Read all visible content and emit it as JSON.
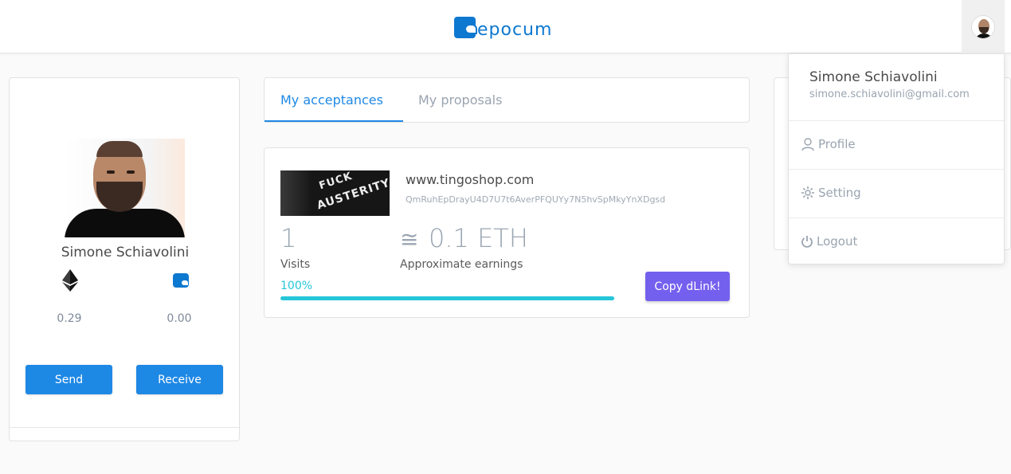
{
  "header": {
    "logo_text": "epocum"
  },
  "profile": {
    "name": "Simone Schiavolini",
    "balances": {
      "eth": "0.29",
      "epc": "0.00"
    },
    "send_label": "Send",
    "receive_label": "Receive"
  },
  "tabs": [
    {
      "label": "My acceptances",
      "active": true
    },
    {
      "label": "My proposals",
      "active": false
    }
  ],
  "acceptance": {
    "site": "www.tingoshop.com",
    "hash": "QmRuhEpDrayU4D7U7t6AverPFQUYy7N5hvSpMkyYnXDgsd",
    "visits": "1",
    "visits_label": "Visits",
    "approx_symbol": "≅",
    "earnings": "0.1 ETH",
    "earnings_label": "Approximate earnings",
    "progress_label": "100%",
    "progress": 1.0,
    "copy_label": "Copy dLink!",
    "thumb_text_1": "FUCK",
    "thumb_text_2": "AUSTERITY"
  },
  "dropdown": {
    "name": "Simone Schiavolini",
    "email": "simone.schiavolini@gmail.com",
    "items": [
      {
        "label": "Profile",
        "icon": "user-icon"
      },
      {
        "label": "Setting",
        "icon": "gear-icon"
      },
      {
        "label": "Logout",
        "icon": "power-icon"
      }
    ]
  },
  "colors": {
    "brand": "#0d78d0",
    "primary": "#1e88e5",
    "accent": "#7460ee",
    "progress": "#26c6da"
  }
}
